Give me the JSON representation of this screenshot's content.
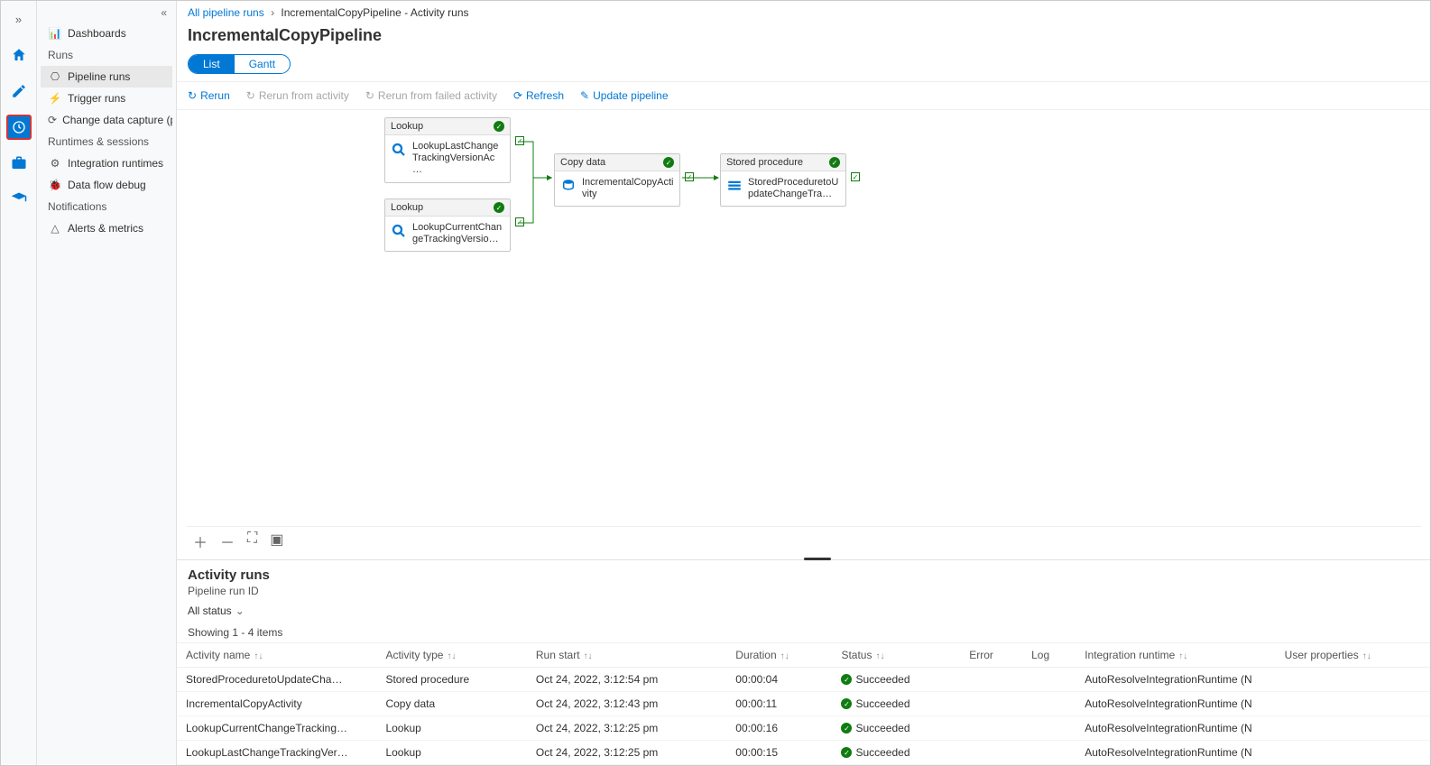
{
  "rail": {
    "expand": "»"
  },
  "sidebar": {
    "collapse": "«",
    "dashboards": "Dashboards",
    "runs_header": "Runs",
    "pipeline_runs": "Pipeline runs",
    "trigger_runs": "Trigger runs",
    "cdc": "Change data capture (previ…",
    "runtimes_header": "Runtimes & sessions",
    "integration_runtimes": "Integration runtimes",
    "data_flow_debug": "Data flow debug",
    "notifications_header": "Notifications",
    "alerts_metrics": "Alerts & metrics"
  },
  "breadcrumbs": {
    "root": "All pipeline runs",
    "current": "IncrementalCopyPipeline - Activity runs"
  },
  "title": "IncrementalCopyPipeline",
  "view_tabs": {
    "list": "List",
    "gantt": "Gantt"
  },
  "toolbar": {
    "rerun": "Rerun",
    "rerun_activity": "Rerun from activity",
    "rerun_failed": "Rerun from failed activity",
    "refresh": "Refresh",
    "update": "Update pipeline"
  },
  "nodes": {
    "lookup1": {
      "kind": "Lookup",
      "name": "LookupLastChangeTrackingVersionAc…"
    },
    "lookup2": {
      "kind": "Lookup",
      "name": "LookupCurrentChangeTrackingVersio…"
    },
    "copy": {
      "kind": "Copy data",
      "name": "IncrementalCopyActivity"
    },
    "sproc": {
      "kind": "Stored procedure",
      "name": "StoredProceduretoUpdateChangeTra…"
    }
  },
  "panel": {
    "title": "Activity runs",
    "run_id_label": "Pipeline run ID",
    "filter": "All status",
    "count": "Showing 1 - 4 items"
  },
  "columns": {
    "activity_name": "Activity name",
    "activity_type": "Activity type",
    "run_start": "Run start",
    "duration": "Duration",
    "status": "Status",
    "error": "Error",
    "log": "Log",
    "integration_runtime": "Integration runtime",
    "user_properties": "User properties"
  },
  "status_label": "Succeeded",
  "rows": [
    {
      "name": "StoredProceduretoUpdateCha…",
      "type": "Stored procedure",
      "start": "Oct 24, 2022, 3:12:54 pm",
      "duration": "00:00:04",
      "ir": "AutoResolveIntegrationRuntime (N"
    },
    {
      "name": "IncrementalCopyActivity",
      "type": "Copy data",
      "start": "Oct 24, 2022, 3:12:43 pm",
      "duration": "00:00:11",
      "ir": "AutoResolveIntegrationRuntime (N"
    },
    {
      "name": "LookupCurrentChangeTracking…",
      "type": "Lookup",
      "start": "Oct 24, 2022, 3:12:25 pm",
      "duration": "00:00:16",
      "ir": "AutoResolveIntegrationRuntime (N"
    },
    {
      "name": "LookupLastChangeTrackingVer…",
      "type": "Lookup",
      "start": "Oct 24, 2022, 3:12:25 pm",
      "duration": "00:00:15",
      "ir": "AutoResolveIntegrationRuntime (N"
    }
  ]
}
